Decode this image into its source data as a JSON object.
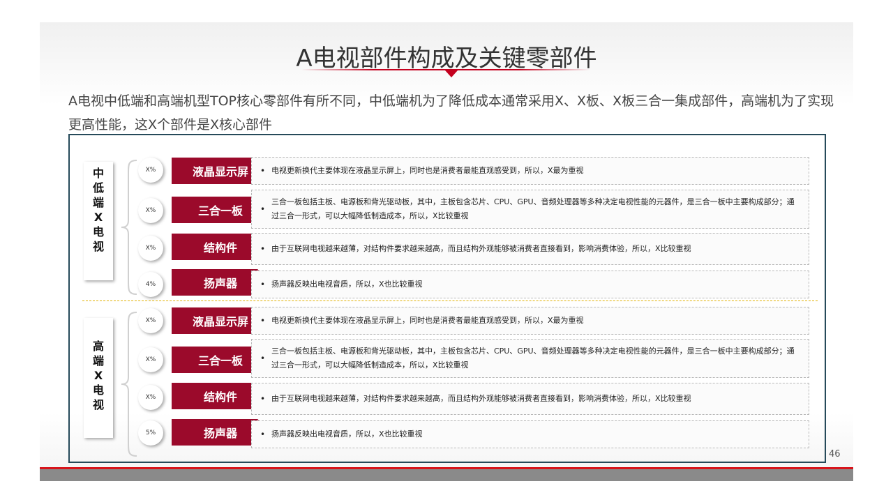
{
  "title": "A电视部件构成及关键零部件",
  "intro": "A电视中低端和高端机型TOP核心零部件有所不同，中低端机为了降低成本通常采用X、X板、X板三合一集成部件，高端机为了实现更高性能，这X个部件是X核心部件",
  "groups": [
    {
      "label": "中\n低\n端\nX\n电\n视",
      "rows": [
        {
          "pct": "X%",
          "name": "液晶显示屏",
          "desc": "电视更新换代主要体现在液晶显示屏上，同时也是消费者最能直观感受到，所以，X最为重视"
        },
        {
          "pct": "X%",
          "name": "三合一板",
          "desc": "三合一板包括主板、电源板和背光驱动板，其中，主板包含芯片、CPU、GPU、音频处理器等多种决定电视性能的元器件，是三合一板中主要构成部分；通过三合一形式，可以大幅降低制造成本，所以，X比较重视"
        },
        {
          "pct": "X%",
          "name": "结构件",
          "desc": "由于互联网电视越来越薄，对结构件要求越来越高，而且结构外观能够被消费者直接看到，影响消费体验，所以，X比较重视"
        },
        {
          "pct": "4%",
          "name": "扬声器",
          "desc": "扬声器反映出电视音质，所以，X也比较重视"
        }
      ]
    },
    {
      "label": "高\n端\nX\n电\n视",
      "rows": [
        {
          "pct": "X%",
          "name": "液晶显示屏",
          "desc": "电视更新换代主要体现在液晶显示屏上，同时也是消费者最能直观感受到，所以，X最为重视"
        },
        {
          "pct": "X%",
          "name": "三合一板",
          "desc": "三合一板包括主板、电源板和背光驱动板，其中，主板包含芯片、CPU、GPU、音频处理器等多种决定电视性能的元器件，是三合一板中主要构成部分；通过三合一形式，可以大幅降低制造成本，所以，X比较重视"
        },
        {
          "pct": "X%",
          "name": "结构件",
          "desc": "由于互联网电视越来越薄，对结构件要求越来越高，而且结构外观能够被消费者直接看到，影响消费体验，所以，X比较重视"
        },
        {
          "pct": "5%",
          "name": "扬声器",
          "desc": "扬声器反映出电视音质，所以，X也比较重视"
        }
      ]
    }
  ],
  "bullet": "•",
  "page_number": "46",
  "colors": {
    "accent": "#9b0a2b",
    "title_red": "#c4001e",
    "frame": "#264a5a",
    "divider": "#e0b000"
  }
}
